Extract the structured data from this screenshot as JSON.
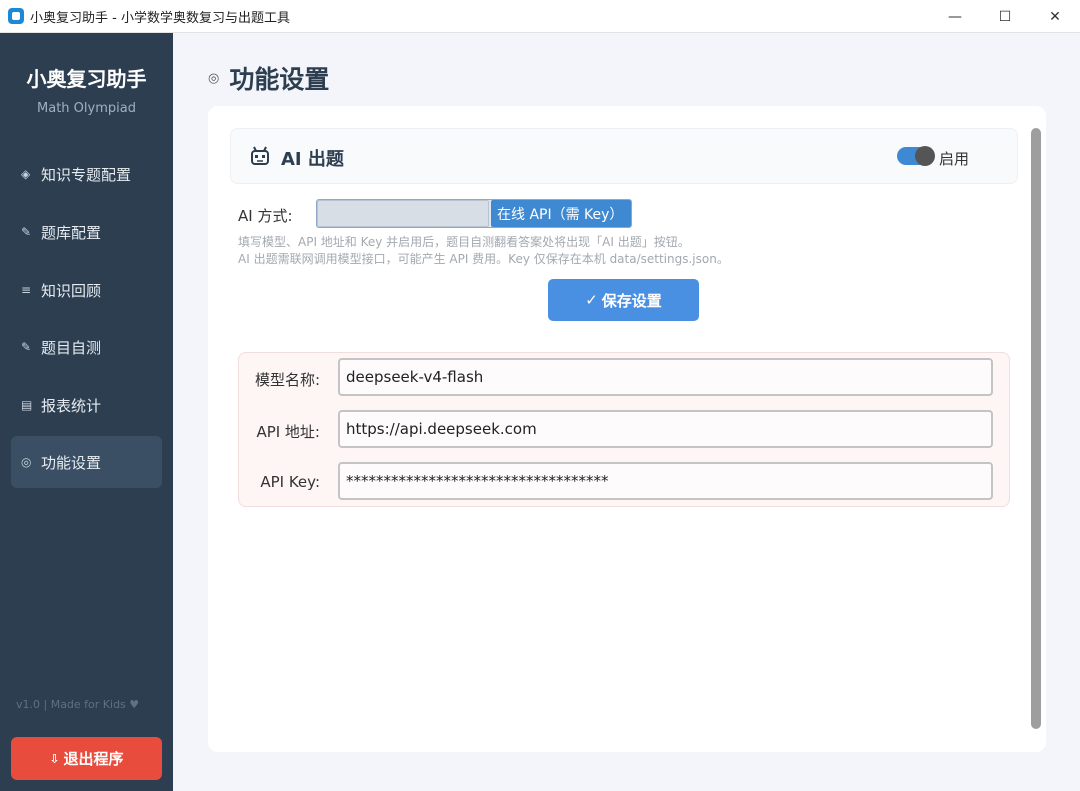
{
  "window": {
    "title": "小奥复习助手 - 小学数学奥数复习与出题工具",
    "controls": {
      "minimize": "—",
      "maximize": "☐",
      "close": "✕"
    }
  },
  "sidebar": {
    "title": "小奥复习助手",
    "subtitle": "Math Olympiad",
    "items": [
      {
        "icon": "◈",
        "label": "知识专题配置"
      },
      {
        "icon": "✎",
        "label": "题库配置"
      },
      {
        "icon": "≡",
        "label": "知识回顾"
      },
      {
        "icon": "✎",
        "label": "题目自测"
      },
      {
        "icon": "▤",
        "label": "报表统计"
      },
      {
        "icon": "◎",
        "label": "功能设置"
      }
    ],
    "active_index": 5,
    "footer": "v1.0 | Made for Kids ♥",
    "exit_icon": "⇩",
    "exit_label": "退出程序"
  },
  "page": {
    "icon": "◎",
    "title": "功能设置"
  },
  "ai_section": {
    "title": "AI 出题",
    "toggle_label": "启用",
    "toggle_on": true,
    "mode_label": "AI 方式:",
    "modes": [
      {
        "label": "",
        "selected": false
      },
      {
        "label": "在线 API（需 Key）",
        "selected": true
      }
    ],
    "hint1": "填写模型、API 地址和 Key 并启用后，题目自测翻看答案处将出现「AI 出题」按钮。",
    "hint2": "AI 出题需联网调用模型接口，可能产生 API 费用。Key 仅保存在本机 data/settings.json。",
    "save_icon": "✓",
    "save_label": "保存设置",
    "fields": [
      {
        "label": "模型名称:",
        "value": "deepseek-v4-flash"
      },
      {
        "label": "API 地址:",
        "value": "https://api.deepseek.com"
      },
      {
        "label": "API Key:",
        "value": "***********************************"
      }
    ]
  },
  "colors": {
    "sidebar_bg": "#2c3e50",
    "accent": "#4a90e2",
    "danger": "#e84c3d"
  }
}
